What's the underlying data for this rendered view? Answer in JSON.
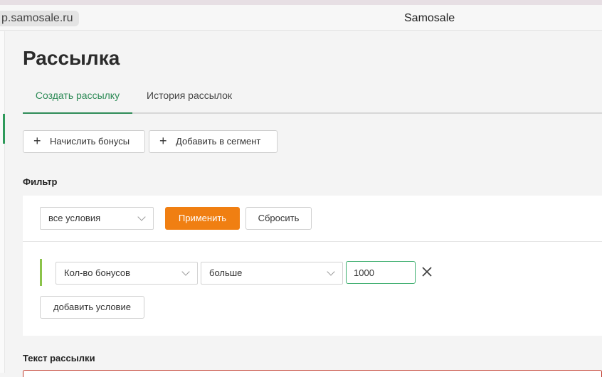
{
  "browser": {
    "url": "p.samosale.ru",
    "tab_title": "Samosale"
  },
  "page": {
    "title": "Рассылка",
    "tabs": [
      {
        "label": "Создать рассылку",
        "active": true
      },
      {
        "label": "История рассылок",
        "active": false
      }
    ]
  },
  "actions": {
    "add_bonus_label": "Начислить бонусы",
    "add_segment_label": "Добавить в сегмент"
  },
  "filter": {
    "label": "Фильтр",
    "conditions_select": "все условия",
    "apply_label": "Применить",
    "reset_label": "Сбросить",
    "condition": {
      "field": "Кол-во бонусов",
      "operator": "больше",
      "value": "1000"
    },
    "add_condition_label": "добавить условие"
  },
  "message": {
    "label": "Текст рассылки"
  },
  "colors": {
    "accent_green": "#2e8b57",
    "apply_orange": "#f07f12",
    "condition_accent": "#8bc34a",
    "error_red": "#c0392b"
  }
}
